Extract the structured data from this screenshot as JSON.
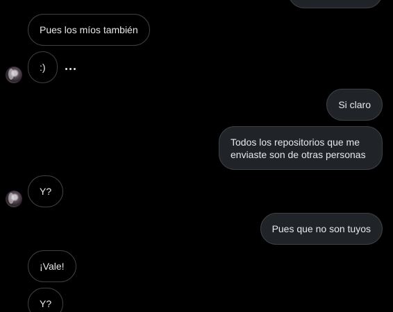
{
  "conversation": {
    "messages": [
      {
        "side": "out",
        "text": ""
      },
      {
        "side": "in",
        "text": "Pues los míos también"
      },
      {
        "side": "in",
        "text": ":)"
      },
      {
        "side": "out",
        "text": "Si claro"
      },
      {
        "side": "out",
        "text": "Todos los repositorios que me enviaste son de otras personas"
      },
      {
        "side": "in",
        "text": "Y?"
      },
      {
        "side": "out",
        "text": "Pues que no son tuyos"
      },
      {
        "side": "in",
        "text": "¡Vale!"
      },
      {
        "side": "in",
        "text": "Y?"
      }
    ]
  },
  "icons": {
    "avatar": "contact-avatar",
    "typing": "typing-indicator-icon"
  },
  "colors": {
    "background": "#000000",
    "incoming_bubble_border": "#3e4144",
    "outgoing_bubble_fill": "#202327",
    "text": "#e7e9ea"
  }
}
